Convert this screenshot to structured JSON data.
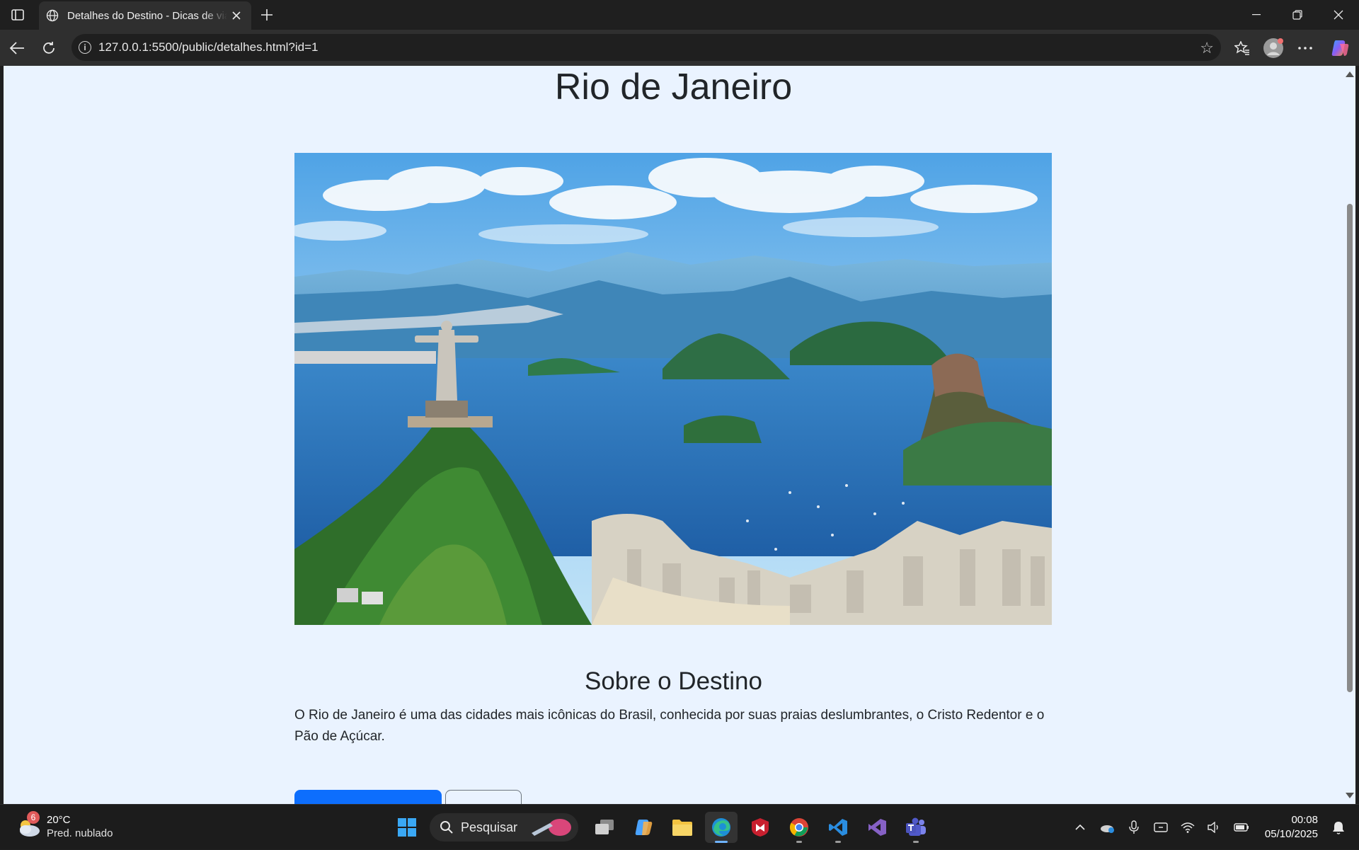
{
  "browser": {
    "tab_title": "Detalhes do Destino - Dicas de viagem",
    "url": "127.0.0.1:5500/public/detalhes.html?id=1"
  },
  "page": {
    "title": "Rio de Janeiro",
    "section_title": "Sobre o Destino",
    "description": "O Rio de Janeiro é uma das cidades mais icônicas do Brasil, conhecida por suas praias deslumbrantes, o Cristo Redentor e o Pão de Açúcar."
  },
  "taskbar": {
    "weather_temp": "20°C",
    "weather_desc": "Pred. nublado",
    "weather_badge": "6",
    "search_placeholder": "Pesquisar",
    "time": "00:08",
    "date": "05/10/2025"
  },
  "colors": {
    "accent": "#0d6efd",
    "page_bg": "#eaf3ff",
    "text": "#212529"
  }
}
